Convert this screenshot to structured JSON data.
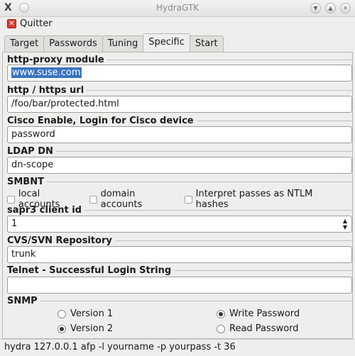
{
  "window": {
    "title": "HydraGTK",
    "app_icon": "X",
    "minimize_icon": "chevron-down-icon",
    "maximize_icon": "chevron-up-icon",
    "close_icon": "close-icon"
  },
  "menu": {
    "quit_label": "Quitter",
    "quit_icon": "close-icon"
  },
  "tabs": [
    {
      "label": "Target",
      "active": false
    },
    {
      "label": "Passwords",
      "active": false
    },
    {
      "label": "Tuning",
      "active": false
    },
    {
      "label": "Specific",
      "active": true
    },
    {
      "label": "Start",
      "active": false
    }
  ],
  "specific": {
    "http_proxy": {
      "label": "http-proxy module",
      "value": "www.suse.com"
    },
    "http_url": {
      "label": "http / https url",
      "value": "/foo/bar/protected.html"
    },
    "cisco": {
      "label": "Cisco Enable, Login for Cisco device",
      "value": "password"
    },
    "ldap": {
      "label": "LDAP DN",
      "value": "dn-scope"
    },
    "smbnt": {
      "label": "SMBNT",
      "options": [
        {
          "label": "local accounts",
          "checked": false
        },
        {
          "label": "domain accounts",
          "checked": false
        },
        {
          "label": "Interpret passes as NTLM hashes",
          "checked": false
        }
      ]
    },
    "sapr3": {
      "label": "sapr3 client id",
      "value": "1"
    },
    "cvs": {
      "label": "CVS/SVN Repository",
      "value": "trunk"
    },
    "telnet": {
      "label": "Telnet - Successful Login String",
      "value": ""
    },
    "snmp": {
      "label": "SNMP",
      "version1": {
        "label": "Version 1",
        "selected": false
      },
      "version2": {
        "label": "Version 2",
        "selected": true
      },
      "write_password": {
        "label": "Write Password",
        "selected": true
      },
      "read_password": {
        "label": "Read Password",
        "selected": false
      }
    }
  },
  "status": {
    "command": "hydra 127.0.0.1 afp -l yourname -p yourpass -t 36"
  },
  "colors": {
    "selection": "#3a74c2",
    "quit_icon": "#d93b2b"
  }
}
